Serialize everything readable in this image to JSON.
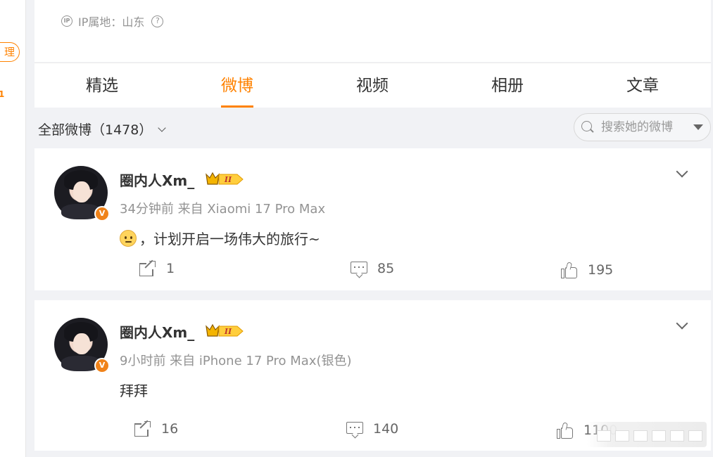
{
  "sidebar": {
    "manage_label": "理",
    "badge_text": "1"
  },
  "profile": {
    "ip_label": "IP属地：山东",
    "ip_icon": "ip-icon",
    "help_icon": "help-icon"
  },
  "tabs": [
    {
      "label": "精选",
      "active": false
    },
    {
      "label": "微博",
      "active": true
    },
    {
      "label": "视频",
      "active": false
    },
    {
      "label": "相册",
      "active": false
    },
    {
      "label": "文章",
      "active": false
    }
  ],
  "filter": {
    "label": "全部微博（1478）"
  },
  "search": {
    "placeholder": "搜索她的微博"
  },
  "accent_color": "#ff8200",
  "posts": [
    {
      "username": "圈内人Xm_",
      "verified_badge": "V",
      "vip_level": "II",
      "meta": "34分钟前 来自 Xiaomi 17 Pro Max",
      "emoji": "smile-emoji",
      "text": "，计划开启一场伟大的旅行~",
      "shares": "1",
      "comments": "85",
      "likes": "195"
    },
    {
      "username": "圈内人Xm_",
      "verified_badge": "V",
      "vip_level": "II",
      "meta": "9小时前 来自 iPhone 17 Pro Max(银色)",
      "text": "拜拜",
      "shares": "16",
      "comments": "140",
      "likes": "1100"
    }
  ]
}
